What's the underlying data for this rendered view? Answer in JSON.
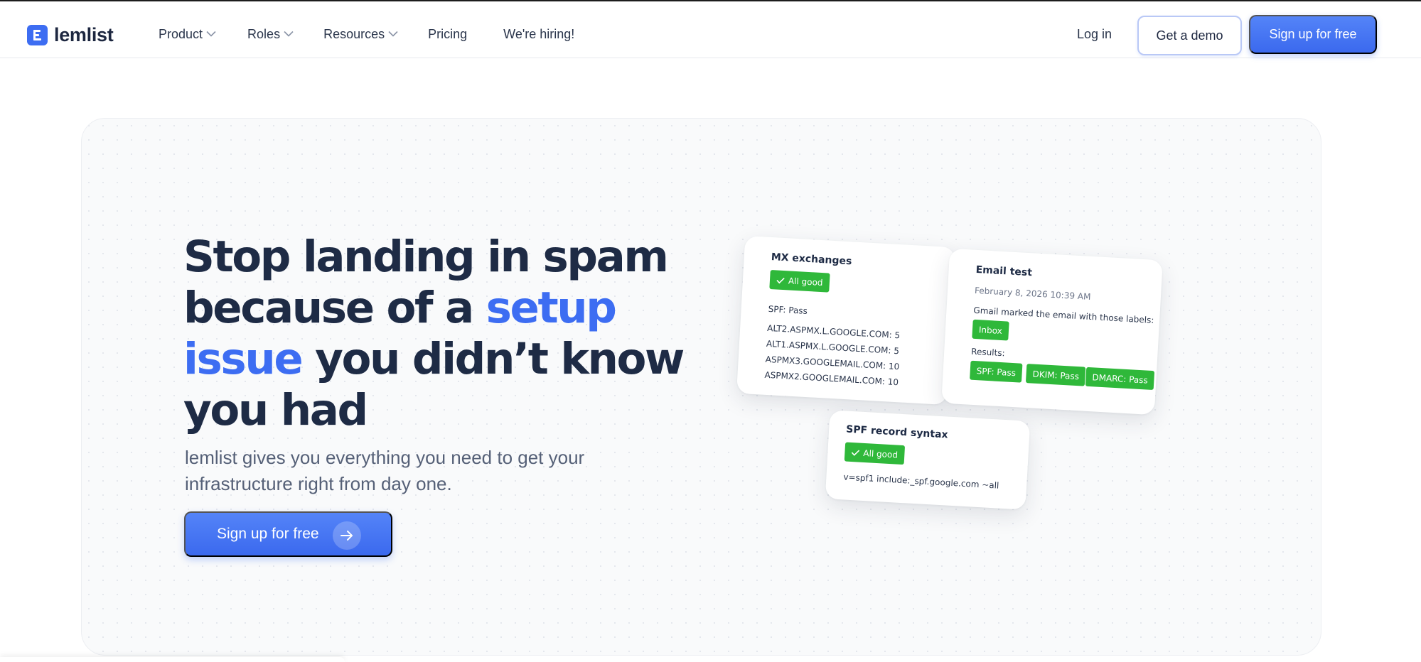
{
  "nav": {
    "logo": "lemlist",
    "items": [
      {
        "label": "Product",
        "dropdown": true
      },
      {
        "label": "Roles",
        "dropdown": true
      },
      {
        "label": "Resources",
        "dropdown": true
      },
      {
        "label": "Pricing",
        "dropdown": false
      },
      {
        "label": "We're hiring!",
        "dropdown": false
      }
    ],
    "login": "Log in",
    "demo": "Get a demo",
    "signup": "Sign up for free"
  },
  "hero": {
    "headline_part1": "Stop landing in spam because of a ",
    "headline_highlight": "setup issue",
    "headline_part2": " you didn’t know you had",
    "subline": "lemlist gives you everything you need to get your infrastructure right from day one.",
    "cta": "Sign up for free"
  },
  "cards": {
    "mx": {
      "title": "MX exchanges",
      "badge": "All good",
      "lines": [
        "SPF: Pass",
        "ALT2.ASPMX.L.GOOGLE.COM: 5",
        "ALT1.ASPMX.L.GOOGLE.COM: 5",
        "ASPMX3.GOOGLEMAIL.COM: 10",
        "ASPMX2.GOOGLEMAIL.COM: 10"
      ]
    },
    "email": {
      "title": "Email test",
      "date": "February 8, 2026 10:39 AM",
      "labels_text": "Gmail marked the email with those labels:",
      "label_badge": "Inbox",
      "results_label": "Results:",
      "results": [
        "SPF: Pass",
        "DKIM: Pass",
        "DMARC: Pass"
      ]
    },
    "spf": {
      "title": "SPF record syntax",
      "badge": "All good",
      "record": "v=spf1 include:_spf.google.com ~all"
    }
  },
  "colors": {
    "brand": "#3d6df2",
    "text": "#1e2b45",
    "success": "#2fb83a"
  }
}
